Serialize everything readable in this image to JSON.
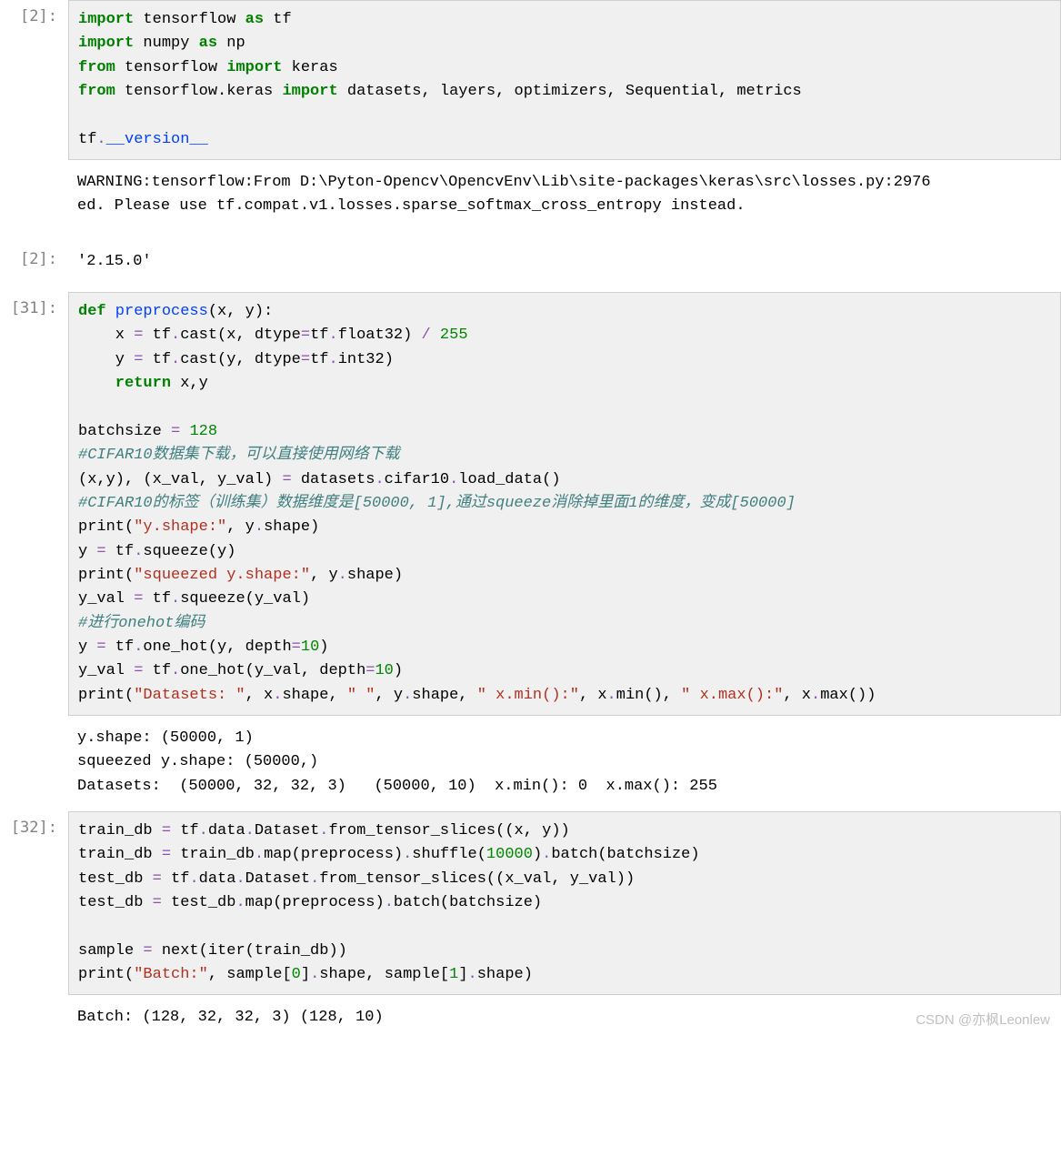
{
  "cells": {
    "c1": {
      "prompt": "[2]:",
      "code": {
        "l1_kw1": "import",
        "l1_mod": " tensorflow ",
        "l1_kw2": "as",
        "l1_al": " tf",
        "l2_kw1": "import",
        "l2_mod": " numpy ",
        "l2_kw2": "as",
        "l2_al": " np",
        "l3_kw1": "from",
        "l3_mod": " tensorflow ",
        "l3_kw2": "import",
        "l3_imp": " keras",
        "l4_kw1": "from",
        "l4_mod": " tensorflow.keras ",
        "l4_kw2": "import",
        "l4_imp": " datasets, layers, optimizers, Sequential, metrics",
        "l5_blank": "",
        "l6_a": "tf",
        "l6_dot": ".",
        "l6_d": "__version__"
      }
    },
    "c1out": {
      "text": "WARNING:tensorflow:From D:\\Pyton-Opencv\\OpencvEnv\\Lib\\site-packages\\keras\\src\\losses.py:2976\ned. Please use tf.compat.v1.losses.sparse_softmax_cross_entropy instead."
    },
    "c1res": {
      "prompt": "[2]:",
      "text": "'2.15.0'"
    },
    "c2": {
      "prompt": "[31]:",
      "code": {
        "d_kw": "def",
        "d_fn": " preprocess",
        "d_sig": "(x, y):",
        "b1_a": "    x ",
        "b1_op": "=",
        "b1_b": " tf",
        "b1_dot": ".",
        "b1_fn": "cast",
        "b1_c": "(x, dtype",
        "b1_eq": "=",
        "b1_d": "tf",
        "b1_dot2": ".",
        "b1_e": "float32) ",
        "b1_div": "/",
        "b1_sp": " ",
        "b1_num": "255",
        "b2_a": "    y ",
        "b2_op": "=",
        "b2_b": " tf",
        "b2_dot": ".",
        "b2_fn": "cast",
        "b2_c": "(y, dtype",
        "b2_eq": "=",
        "b2_d": "tf",
        "b2_dot2": ".",
        "b2_e": "int32)",
        "b3_kw": "    return",
        "b3_r": " x,y",
        "blank1": "",
        "bs_a": "batchsize ",
        "bs_op": "=",
        "bs_sp": " ",
        "bs_num": "128",
        "cm1": "#CIFAR10数据集下载，可以直接使用网络下载",
        "ld_a": "(x,y), (x_val, y_val) ",
        "ld_op": "=",
        "ld_b": " datasets",
        "ld_dot": ".",
        "ld_c": "cifar10",
        "ld_dot2": ".",
        "ld_fn": "load_data",
        "ld_d": "()",
        "cm2": "#CIFAR10的标签（训练集）数据维度是[50000, 1],通过squeeze消除掉里面1的维度，变成[50000]",
        "p1_a": "print(",
        "p1_s": "\"y.shape:\"",
        "p1_b": ", y",
        "p1_dot": ".",
        "p1_c": "shape)",
        "sq1_a": "y ",
        "sq1_op": "=",
        "sq1_b": " tf",
        "sq1_dot": ".",
        "sq1_fn": "squeeze",
        "sq1_c": "(y)",
        "p2_a": "print(",
        "p2_s": "\"squeezed y.shape:\"",
        "p2_b": ", y",
        "p2_dot": ".",
        "p2_c": "shape)",
        "sq2_a": "y_val ",
        "sq2_op": "=",
        "sq2_b": " tf",
        "sq2_dot": ".",
        "sq2_fn": "squeeze",
        "sq2_c": "(y_val)",
        "cm3": "#进行onehot编码",
        "oh1_a": "y ",
        "oh1_op": "=",
        "oh1_b": " tf",
        "oh1_dot": ".",
        "oh1_fn": "one_hot",
        "oh1_c": "(y, depth",
        "oh1_eq": "=",
        "oh1_num": "10",
        "oh1_d": ")",
        "oh2_a": "y_val ",
        "oh2_op": "=",
        "oh2_b": " tf",
        "oh2_dot": ".",
        "oh2_fn": "one_hot",
        "oh2_c": "(y_val, depth",
        "oh2_eq": "=",
        "oh2_num": "10",
        "oh2_d": ")",
        "p3_a": "print(",
        "p3_s1": "\"Datasets: \"",
        "p3_b": ", x",
        "p3_dot": ".",
        "p3_c": "shape, ",
        "p3_s2": "\" \"",
        "p3_d": ", y",
        "p3_dot2": ".",
        "p3_e": "shape, ",
        "p3_s3": "\" x.min():\"",
        "p3_f": ", x",
        "p3_dot3": ".",
        "p3_fn1": "min",
        "p3_g": "(), ",
        "p3_s4": "\" x.max():\"",
        "p3_h": ", x",
        "p3_dot4": ".",
        "p3_fn2": "max",
        "p3_i": "())"
      },
      "out": "y.shape: (50000, 1)\nsqueezed y.shape: (50000,)\nDatasets:  (50000, 32, 32, 3)   (50000, 10)  x.min(): 0  x.max(): 255"
    },
    "c3": {
      "prompt": "[32]:",
      "code": {
        "t1_a": "train_db ",
        "t1_op": "=",
        "t1_b": " tf",
        "t1_d1": ".",
        "t1_c": "data",
        "t1_d2": ".",
        "t1_d": "Dataset",
        "t1_d3": ".",
        "t1_fn": "from_tensor_slices",
        "t1_e": "((x, y))",
        "t2_a": "train_db ",
        "t2_op": "=",
        "t2_b": " train_db",
        "t2_d1": ".",
        "t2_fn1": "map",
        "t2_c": "(preprocess)",
        "t2_d2": ".",
        "t2_fn2": "shuffle",
        "t2_d": "(",
        "t2_num": "10000",
        "t2_e": ")",
        "t2_d3": ".",
        "t2_fn3": "batch",
        "t2_f": "(batchsize)",
        "t3_a": "test_db ",
        "t3_op": "=",
        "t3_b": " tf",
        "t3_d1": ".",
        "t3_c": "data",
        "t3_d2": ".",
        "t3_d": "Dataset",
        "t3_d3": ".",
        "t3_fn": "from_tensor_slices",
        "t3_e": "((x_val, y_val))",
        "t4_a": "test_db ",
        "t4_op": "=",
        "t4_b": " test_db",
        "t4_d1": ".",
        "t4_fn1": "map",
        "t4_c": "(preprocess)",
        "t4_d2": ".",
        "t4_fn2": "batch",
        "t4_d": "(batchsize)",
        "blank": "",
        "s_a": "sample ",
        "s_op": "=",
        "s_b": " next(iter(train_db))",
        "p_a": "print(",
        "p_s": "\"Batch:\"",
        "p_b": ", sample[",
        "p_n0": "0",
        "p_c": "]",
        "p_d1": ".",
        "p_d": "shape, sample[",
        "p_n1": "1",
        "p_e": "]",
        "p_d2": ".",
        "p_f": "shape)"
      },
      "out": "Batch: (128, 32, 32, 3) (128, 10)"
    }
  },
  "watermark": "CSDN @亦枫Leonlew"
}
